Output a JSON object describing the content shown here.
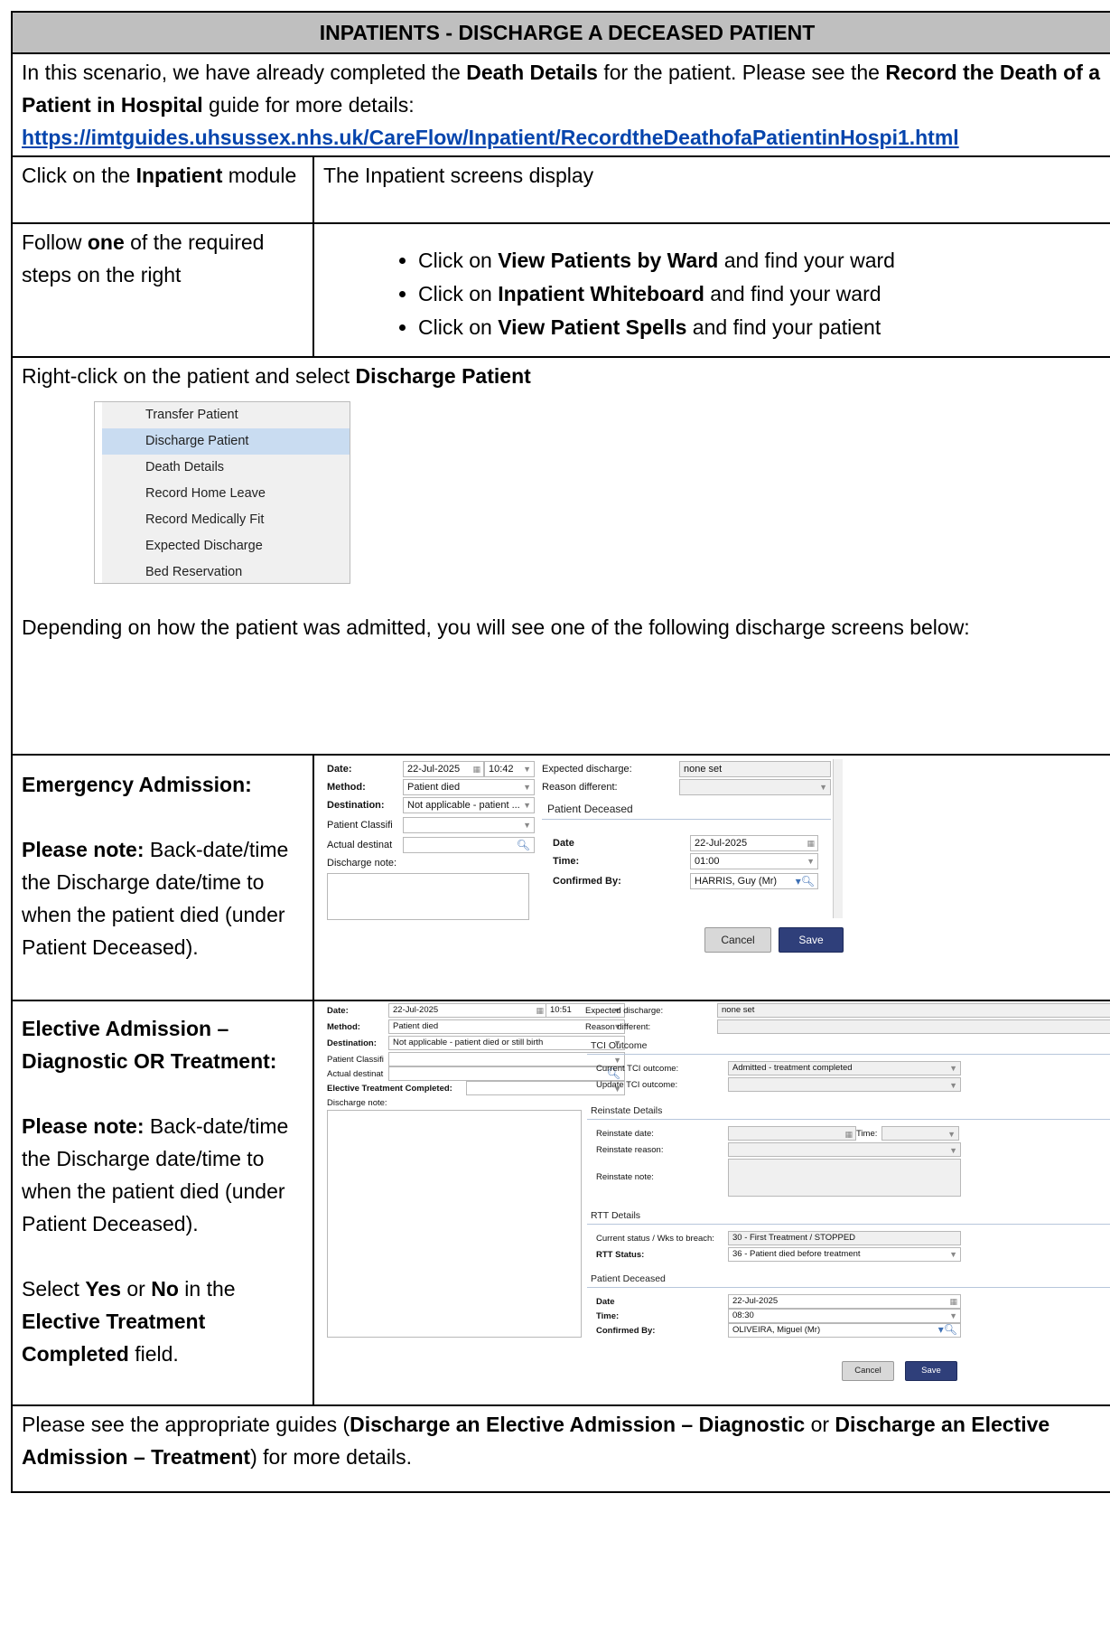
{
  "title": "INPATIENTS - DISCHARGE A DECEASED PATIENT",
  "intro": {
    "t1": "In this scenario, we have already completed the ",
    "b1": "Death Details",
    "t2": " for the patient. Please see the ",
    "b2": "Record the Death of a Patient in Hospital",
    "t3": " guide for more details:",
    "link": "https://imtguides.uhsussex.nhs.uk/CareFlow/Inpatient/RecordtheDeathofaPatientinHospi1.html"
  },
  "row1": {
    "a1": "Click on the ",
    "ab": "Inpatient",
    "a2": " module",
    "right": "The Inpatient screens display"
  },
  "row2": {
    "a1": "Follow ",
    "ab": "one",
    "a2": " of the required steps on the right",
    "steps": [
      {
        "p": "Click on ",
        "b": "View Patients by Ward",
        "s": " and find your ward"
      },
      {
        "p": "Click on ",
        "b": "Inpatient Whiteboard",
        "s": " and find your ward"
      },
      {
        "p": "Click on ",
        "b": "View Patient Spells",
        "s": " and find your patient"
      }
    ]
  },
  "row3": {
    "t1": "Right-click on the patient and select ",
    "b1": "Discharge Patient",
    "menu": [
      "Transfer Patient",
      "Discharge Patient",
      "Death Details",
      "Record Home Leave",
      "Record Medically Fit",
      "Expected Discharge",
      "Bed Reservation"
    ],
    "after": "Depending on how the patient was admitted, you will see one of the following discharge screens below:"
  },
  "emergency": {
    "heading": "Emergency Admission:",
    "noteb": "Please note:",
    "note": " Back-date/time the Discharge date/time to when the patient died (under Patient Deceased).",
    "form": {
      "date_lbl": "Date:",
      "date": "22-Jul-2025",
      "time": "10:42",
      "method_lbl": "Method:",
      "method": "Patient died",
      "dest_lbl": "Destination:",
      "dest": "Not applicable - patient ...",
      "pclass_lbl": "Patient Classifi",
      "actual_lbl": "Actual destinat",
      "note_lbl": "Discharge note:",
      "exp_lbl": "Expected discharge:",
      "exp": "none set",
      "reason_lbl": "Reason different:",
      "deceased": "Patient Deceased",
      "d_date_lbl": "Date",
      "d_date": "22-Jul-2025",
      "d_time_lbl": "Time:",
      "d_time": "01:00",
      "d_conf_lbl": "Confirmed By:",
      "d_conf": "HARRIS, Guy (Mr)",
      "cancel": "Cancel",
      "save": "Save"
    }
  },
  "elective": {
    "heading": "Elective Admission – Diagnostic OR Treatment:",
    "noteb": "Please note:",
    "note": " Back-date/time the Discharge date/time to when the patient died (under Patient Deceased).",
    "sel1": "Select ",
    "yes": "Yes",
    "or": " or ",
    "no": "No",
    "sel2": " in the ",
    "field": "Elective Treatment Completed",
    "sel3": " field.",
    "form": {
      "date_lbl": "Date:",
      "date": "22-Jul-2025",
      "time": "10:51",
      "method_lbl": "Method:",
      "method": "Patient died",
      "dest_lbl": "Destination:",
      "dest": "Not applicable - patient died or still birth",
      "pclass_lbl": "Patient Classifi",
      "actual_lbl": "Actual destinat",
      "etc_lbl": "Elective Treatment Completed:",
      "note_lbl": "Discharge note:",
      "exp_lbl": "Expected discharge:",
      "exp": "none set",
      "reason_lbl": "Reason different:",
      "tci": "TCI Outcome",
      "cur_tci_lbl": "Current TCI outcome:",
      "cur_tci": "Admitted - treatment completed",
      "upd_tci_lbl": "Update TCI outcome:",
      "reinstate": "Reinstate Details",
      "r_date_lbl": "Reinstate date:",
      "r_time_lbl": "Time:",
      "r_reason_lbl": "Reinstate reason:",
      "r_note_lbl": "Reinstate note:",
      "rtt": "RTT Details",
      "cur_status_lbl": "Current status / Wks to breach:",
      "cur_status": "30 - First Treatment / STOPPED",
      "rtt_status_lbl": "RTT Status:",
      "rtt_status": "36 - Patient died before treatment",
      "deceased": "Patient Deceased",
      "d_date_lbl": "Date",
      "d_date": "22-Jul-2025",
      "d_time_lbl": "Time:",
      "d_time": "08:30",
      "d_conf_lbl": "Confirmed By:",
      "d_conf": "OLIVEIRA, Miguel (Mr)",
      "cancel": "Cancel",
      "save": "Save"
    }
  },
  "footer": {
    "t1": "Please see the appropriate guides (",
    "b1": "Discharge an Elective Admission – Diagnostic",
    "t2": " or ",
    "b2": "Discharge an Elective Admission – Treatment",
    "t3": ") for more details."
  }
}
